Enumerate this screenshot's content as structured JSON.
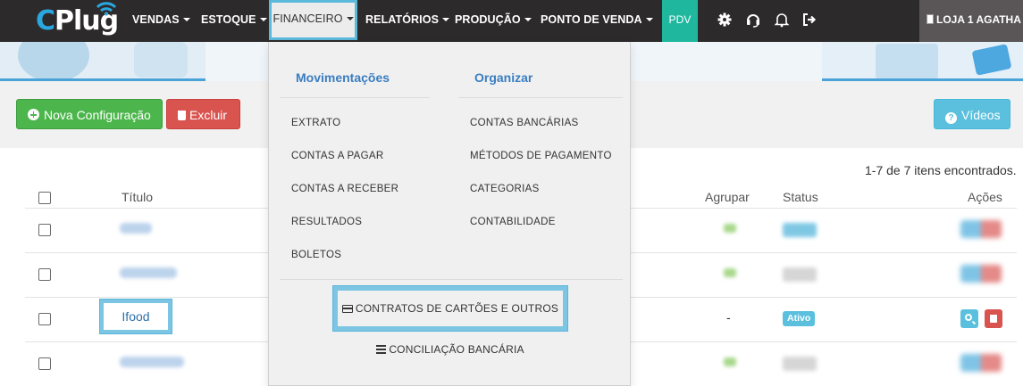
{
  "brand": {
    "logo_text": "Plug",
    "logo_c": "C"
  },
  "nav": {
    "items": [
      "VENDAS",
      "ESTOQUE",
      "FINANCEIRO",
      "RELATÓRIOS",
      "PRODUÇÃO",
      "PONTO DE VENDA"
    ],
    "pdv": "PDV",
    "icons": [
      "gear-icon",
      "headset-icon",
      "bell-icon",
      "logout-icon"
    ],
    "store": "LOJA 1 AGATHA"
  },
  "toolbar": {
    "new_config": "Nova Configuração",
    "delete": "Excluir",
    "videos": "Vídeos"
  },
  "table": {
    "count_text": "1-7 de 7 itens encontrados.",
    "headers": {
      "title": "Título",
      "group": "Agrupar",
      "status": "Status",
      "actions": "Ações"
    },
    "visible_row": {
      "title": "Ifood",
      "group": "-",
      "status": "Ativo"
    }
  },
  "dropdown": {
    "col1": {
      "heading": "Movimentações",
      "items": [
        "EXTRATO",
        "CONTAS A PAGAR",
        "CONTAS A RECEBER",
        "RESULTADOS",
        "BOLETOS"
      ]
    },
    "col2": {
      "heading": "Organizar",
      "items": [
        "CONTAS BANCÁRIAS",
        "MÉTODOS DE PAGAMENTO",
        "CATEGORIAS",
        "CONTABILIDADE"
      ]
    },
    "contratos": "CONTRATOS DE CARTÕES E OUTROS",
    "conciliacao": "CONCILIAÇÃO BANCÁRIA"
  },
  "colors": {
    "nav_bg": "#2d2a2b",
    "pdv": "#1fb89f",
    "accent_blue": "#5bc0de",
    "green": "#4cb64c",
    "red": "#d9534f",
    "highlight": "#7cc5e3"
  }
}
